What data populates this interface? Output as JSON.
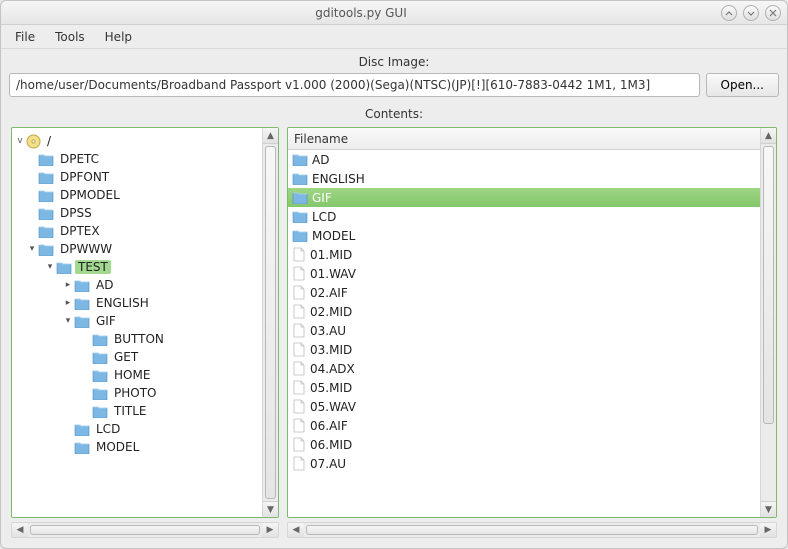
{
  "window": {
    "title": "gditools.py GUI"
  },
  "menu": {
    "file": "File",
    "tools": "Tools",
    "help": "Help"
  },
  "disc": {
    "label": "Disc Image:",
    "path": "/home/user/Documents/Broadband Passport v1.000 (2000)(Sega)(NTSC)(JP)[!][610-7883-0442 1M1, 1M3]",
    "open": "Open..."
  },
  "contents_label": "Contents:",
  "tree": {
    "root": "/",
    "items": [
      {
        "name": "DPETC",
        "depth": 1,
        "expander": ""
      },
      {
        "name": "DPFONT",
        "depth": 1,
        "expander": ""
      },
      {
        "name": "DPMODEL",
        "depth": 1,
        "expander": ""
      },
      {
        "name": "DPSS",
        "depth": 1,
        "expander": ""
      },
      {
        "name": "DPTEX",
        "depth": 1,
        "expander": ""
      },
      {
        "name": "DPWWW",
        "depth": 1,
        "expander": "v"
      },
      {
        "name": "TEST",
        "depth": 2,
        "expander": "v",
        "selected": true
      },
      {
        "name": "AD",
        "depth": 3,
        "expander": ">"
      },
      {
        "name": "ENGLISH",
        "depth": 3,
        "expander": ">"
      },
      {
        "name": "GIF",
        "depth": 3,
        "expander": "v"
      },
      {
        "name": "BUTTON",
        "depth": 4,
        "expander": ""
      },
      {
        "name": "GET",
        "depth": 4,
        "expander": ""
      },
      {
        "name": "HOME",
        "depth": 4,
        "expander": ""
      },
      {
        "name": "PHOTO",
        "depth": 4,
        "expander": ""
      },
      {
        "name": "TITLE",
        "depth": 4,
        "expander": ""
      },
      {
        "name": "LCD",
        "depth": 3,
        "expander": ""
      },
      {
        "name": "MODEL",
        "depth": 3,
        "expander": ""
      }
    ]
  },
  "list": {
    "header": "Filename",
    "rows": [
      {
        "name": "AD",
        "type": "folder"
      },
      {
        "name": "ENGLISH",
        "type": "folder"
      },
      {
        "name": "GIF",
        "type": "folder",
        "selected": true
      },
      {
        "name": "LCD",
        "type": "folder"
      },
      {
        "name": "MODEL",
        "type": "folder"
      },
      {
        "name": "01.MID",
        "type": "file"
      },
      {
        "name": "01.WAV",
        "type": "file"
      },
      {
        "name": "02.AIF",
        "type": "file"
      },
      {
        "name": "02.MID",
        "type": "file"
      },
      {
        "name": "03.AU",
        "type": "file"
      },
      {
        "name": "03.MID",
        "type": "file"
      },
      {
        "name": "04.ADX",
        "type": "file"
      },
      {
        "name": "05.MID",
        "type": "file"
      },
      {
        "name": "05.WAV",
        "type": "file"
      },
      {
        "name": "06.AIF",
        "type": "file"
      },
      {
        "name": "06.MID",
        "type": "file"
      },
      {
        "name": "07.AU",
        "type": "file"
      }
    ]
  }
}
